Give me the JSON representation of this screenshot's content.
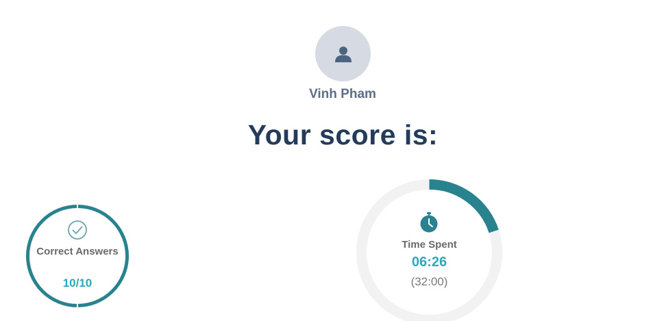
{
  "user": {
    "name": "Vinh Pham",
    "avatar_icon": "user-silhouette-icon"
  },
  "score": {
    "title": "Your score is:"
  },
  "correct_answers": {
    "icon": "check-circle-icon",
    "label": "Correct Answers",
    "value": "10/10",
    "fraction": 1.0,
    "ring_color": "#29838f"
  },
  "time_spent": {
    "icon": "stopwatch-icon",
    "label": "Time Spent",
    "value": "06:26",
    "limit": "(32:00)",
    "fraction": 0.2,
    "ring_color": "#29838f",
    "track_color": "#f2f2f2"
  },
  "colors": {
    "accent": "#2fa8b9",
    "title": "#243b5a",
    "name": "#5c6f86"
  }
}
